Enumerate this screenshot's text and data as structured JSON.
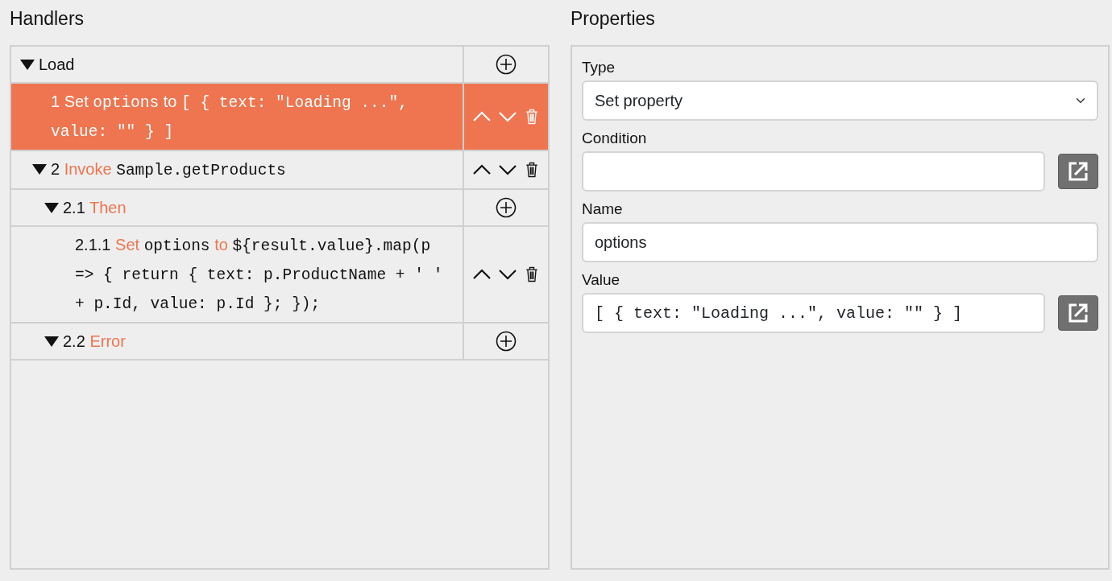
{
  "handlers_panel": {
    "title": "Handlers",
    "tree": [
      {
        "segments": [
          {
            "kind": "plain",
            "text": "Load"
          }
        ],
        "expanded": true,
        "selected": false,
        "kind": "add",
        "children": [
          {
            "segments": [
              {
                "kind": "plain",
                "text": "1"
              },
              {
                "kind": "keyword",
                "text": "Set"
              },
              {
                "kind": "code",
                "text": "options"
              },
              {
                "kind": "keyword",
                "text": "to"
              },
              {
                "kind": "code",
                "text": "[ { text: \"Loading ...\", value: \"\" } ]"
              }
            ],
            "selected": true,
            "kind": "move"
          },
          {
            "segments": [
              {
                "kind": "plain",
                "text": "2"
              },
              {
                "kind": "keyword",
                "text": "Invoke"
              },
              {
                "kind": "code",
                "text": "Sample.getProducts"
              }
            ],
            "expanded": true,
            "selected": false,
            "kind": "move",
            "children": [
              {
                "segments": [
                  {
                    "kind": "plain",
                    "text": "2.1"
                  },
                  {
                    "kind": "keyword",
                    "text": "Then"
                  }
                ],
                "expanded": true,
                "selected": false,
                "kind": "add",
                "children": [
                  {
                    "segments": [
                      {
                        "kind": "plain",
                        "text": "2.1.1"
                      },
                      {
                        "kind": "keyword",
                        "text": "Set"
                      },
                      {
                        "kind": "code",
                        "text": "options"
                      },
                      {
                        "kind": "keyword",
                        "text": "to"
                      },
                      {
                        "kind": "code",
                        "text": "${result.value}.map(p => { return { text: p.ProductName + ' ' + p.Id, value: p.Id }; });"
                      }
                    ],
                    "selected": false,
                    "kind": "move"
                  }
                ]
              },
              {
                "segments": [
                  {
                    "kind": "plain",
                    "text": "2.2"
                  },
                  {
                    "kind": "keyword",
                    "text": "Error"
                  }
                ],
                "expanded": true,
                "selected": false,
                "kind": "add"
              }
            ]
          }
        ]
      }
    ]
  },
  "properties_panel": {
    "title": "Properties",
    "fields": [
      {
        "kind": "select",
        "label": "Type",
        "value": "Set property"
      },
      {
        "kind": "editor",
        "label": "Condition"
      },
      {
        "kind": "text",
        "label": "Name",
        "value": "options"
      },
      {
        "kind": "code-editor",
        "label": "Value",
        "value": "[ { text: \"Loading ...\", value: \"\" } ]"
      }
    ]
  }
}
